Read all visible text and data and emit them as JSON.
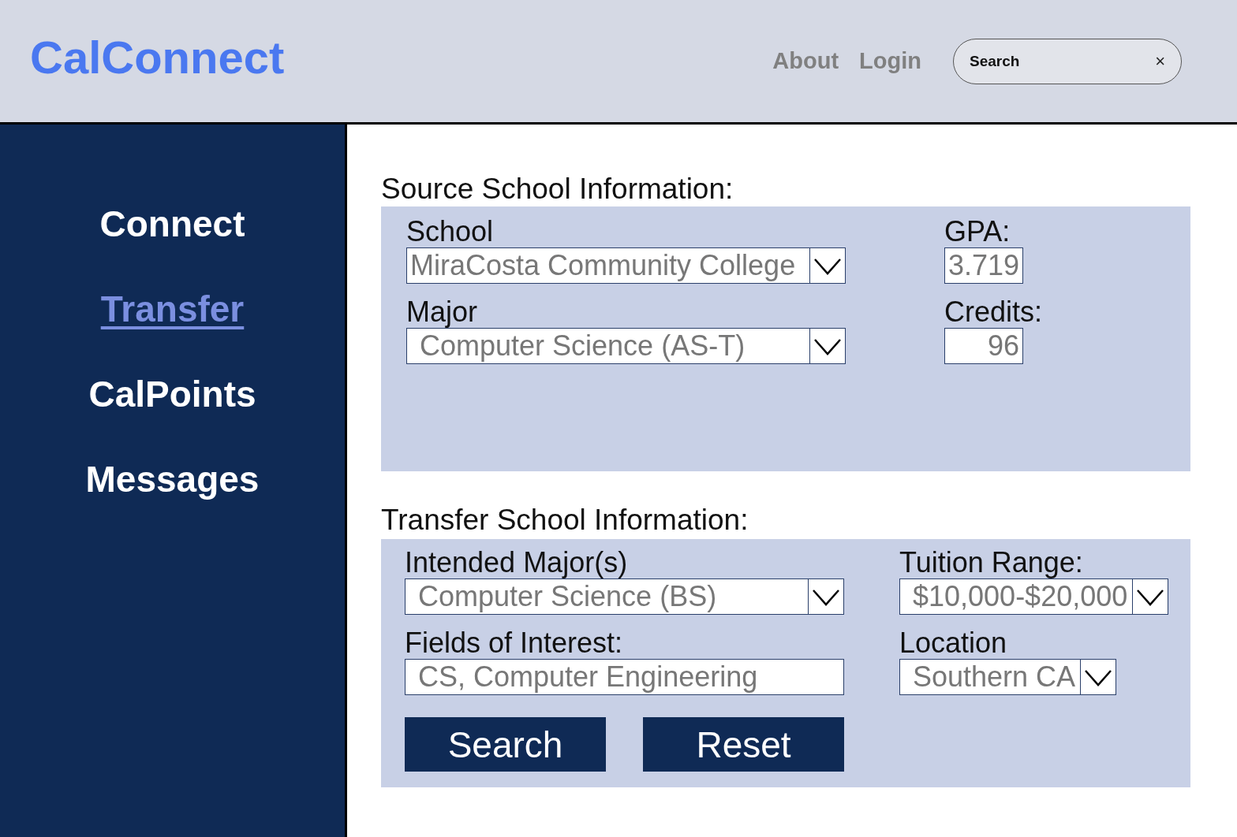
{
  "header": {
    "logo": "CalConnect",
    "nav": [
      "About",
      "Login"
    ],
    "search": {
      "placeholder": "Search",
      "clear": "×"
    }
  },
  "sidebar": {
    "items": [
      {
        "label": "Connect",
        "selected": false
      },
      {
        "label": "Transfer",
        "selected": true
      },
      {
        "label": "CalPoints",
        "selected": false
      },
      {
        "label": "Messages",
        "selected": false
      }
    ]
  },
  "sections": [
    {
      "title": "Source School Information:",
      "left": [
        {
          "kind": "dropdown",
          "label": "School",
          "value": "MiraCosta Community College"
        },
        {
          "kind": "dropdown",
          "label": "Major",
          "value": "Computer Science (AS-T)"
        }
      ],
      "right": [
        {
          "kind": "number",
          "label": "GPA:",
          "value": "3.719"
        },
        {
          "kind": "number",
          "label": "Credits:",
          "value": "96"
        }
      ]
    },
    {
      "title": "Transfer School Information:",
      "left": [
        {
          "kind": "dropdown",
          "label": "Intended Major(s)",
          "value": "Computer Science (BS)"
        },
        {
          "kind": "text",
          "label": "Fields of Interest:",
          "value": "CS, Computer Engineering"
        }
      ],
      "right": [
        {
          "kind": "dropdown",
          "label": "Tuition Range:",
          "value": "$10,000-$20,000"
        },
        {
          "kind": "dropdown",
          "label": "Location",
          "value": "Southern CA"
        }
      ],
      "buttons": [
        "Search",
        "Reset"
      ]
    }
  ]
}
